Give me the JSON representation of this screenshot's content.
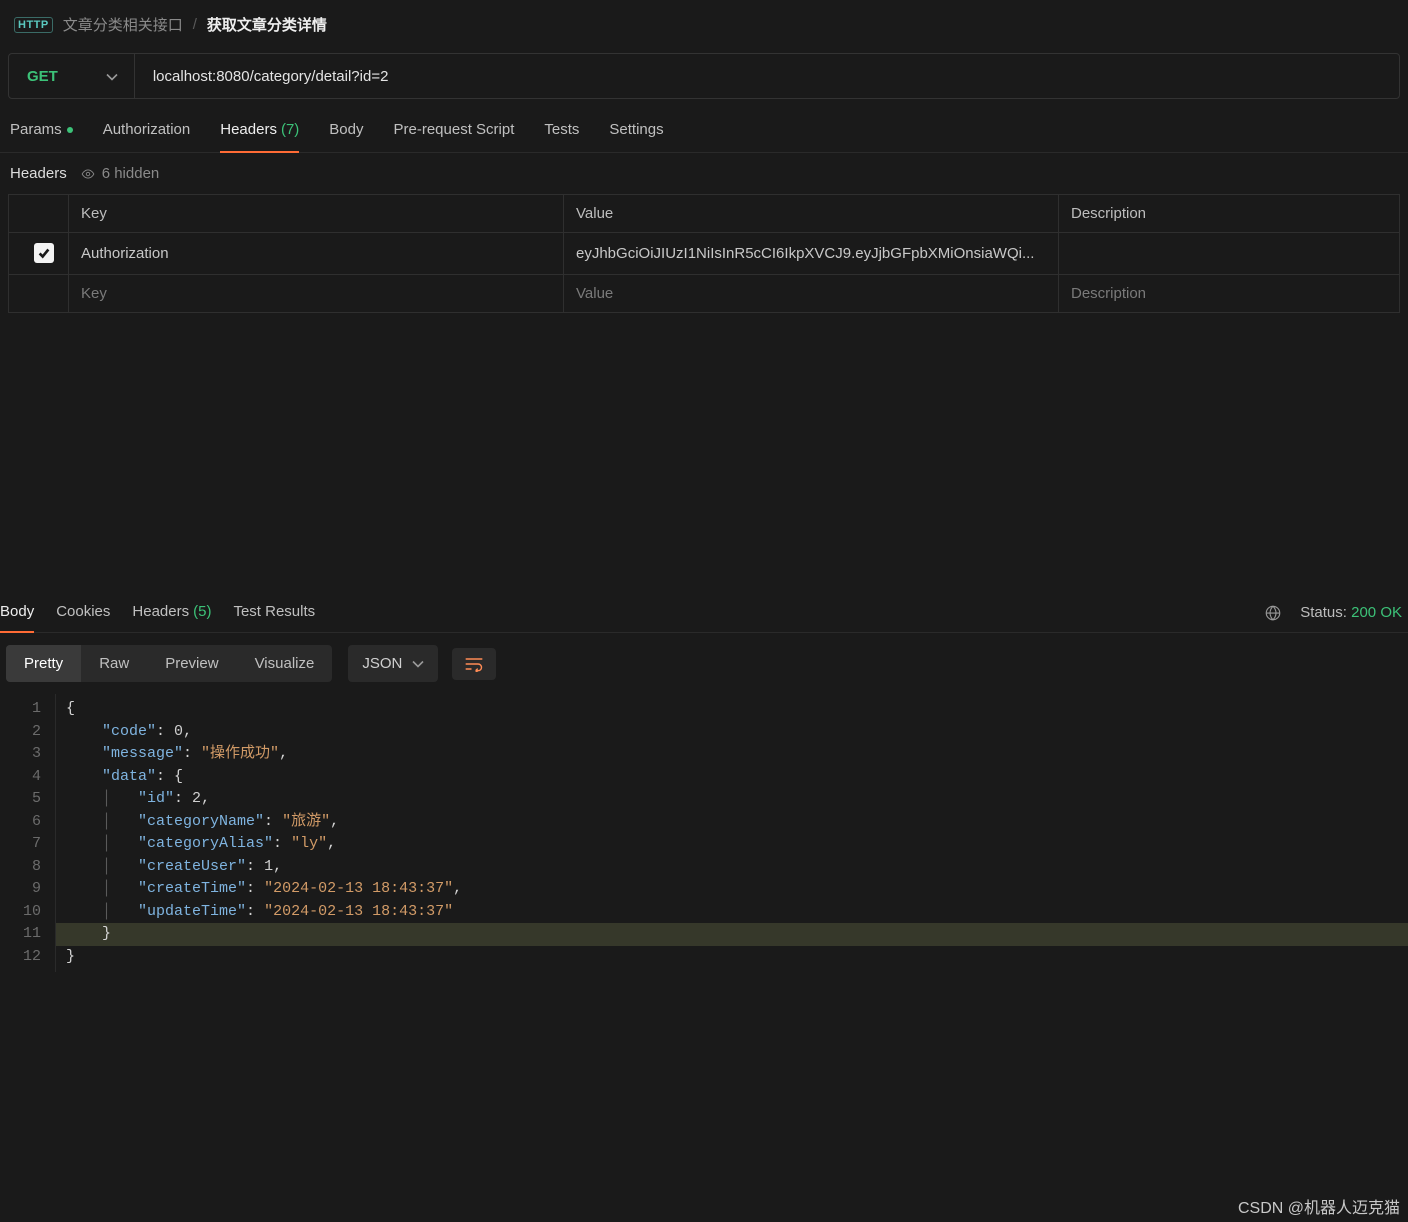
{
  "breadcrumb": {
    "badge": "HTTP",
    "parent": "文章分类相关接口",
    "sep": "/",
    "current": "获取文章分类详情"
  },
  "request": {
    "method": "GET",
    "url": "localhost:8080/category/detail?id=2"
  },
  "tabs": {
    "params": "Params",
    "authorization": "Authorization",
    "headers": "Headers",
    "headers_count": "(7)",
    "body": "Body",
    "prerequest": "Pre-request Script",
    "tests": "Tests",
    "settings": "Settings"
  },
  "headers_section": {
    "title": "Headers",
    "hidden_label": "6 hidden",
    "columns": {
      "key": "Key",
      "value": "Value",
      "description": "Description"
    },
    "rows": [
      {
        "enabled": true,
        "key": "Authorization",
        "value": "eyJhbGciOiJIUzI1NiIsInR5cCI6IkpXVCJ9.eyJjbGFpbXMiOnsiaWQi...",
        "description": ""
      }
    ],
    "placeholder": {
      "key": "Key",
      "value": "Value",
      "description": "Description"
    }
  },
  "response": {
    "tabs": {
      "body": "Body",
      "cookies": "Cookies",
      "headers": "Headers",
      "headers_count": "(5)",
      "tests": "Test Results"
    },
    "status_label": "Status:",
    "status_value": "200 OK",
    "view_tabs": {
      "pretty": "Pretty",
      "raw": "Raw",
      "preview": "Preview",
      "visualize": "Visualize"
    },
    "lang": "JSON"
  },
  "json_body": {
    "code": 0,
    "message": "操作成功",
    "data": {
      "id": 2,
      "categoryName": "旅游",
      "categoryAlias": "ly",
      "createUser": 1,
      "createTime": "2024-02-13 18:43:37",
      "updateTime": "2024-02-13 18:43:37"
    }
  },
  "code_lines": {
    "l1": "{",
    "l2a": "\"code\"",
    "l2b": "0",
    "l3a": "\"message\"",
    "l3b": "\"操作成功\"",
    "l4a": "\"data\"",
    "l5a": "\"id\"",
    "l5b": "2",
    "l6a": "\"categoryName\"",
    "l6b": "\"旅游\"",
    "l7a": "\"categoryAlias\"",
    "l7b": "\"ly\"",
    "l8a": "\"createUser\"",
    "l8b": "1",
    "l9a": "\"createTime\"",
    "l9b": "\"2024-02-13 18:43:37\"",
    "l10a": "\"updateTime\"",
    "l10b": "\"2024-02-13 18:43:37\"",
    "l11": "}",
    "l12": "}"
  },
  "watermark": "CSDN @机器人迈克猫"
}
